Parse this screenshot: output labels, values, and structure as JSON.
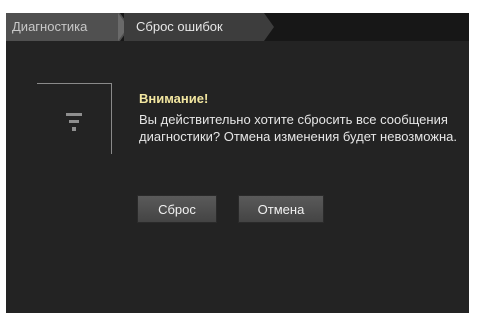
{
  "breadcrumb": {
    "items": [
      {
        "label": "Диагностика"
      },
      {
        "label": "Сброс ошибок"
      }
    ]
  },
  "dialog": {
    "icon": "wifi-warning-icon",
    "title": "Внимание!",
    "message": "Вы действительно хотите сбросить все сообщения диагностики? Отмена изменения будет невозможна.",
    "buttons": {
      "reset_label": "Сброс",
      "cancel_label": "Отмена"
    }
  },
  "colors": {
    "background": "#232323",
    "title": "#f2e6a0",
    "text": "#e6e6e6"
  }
}
